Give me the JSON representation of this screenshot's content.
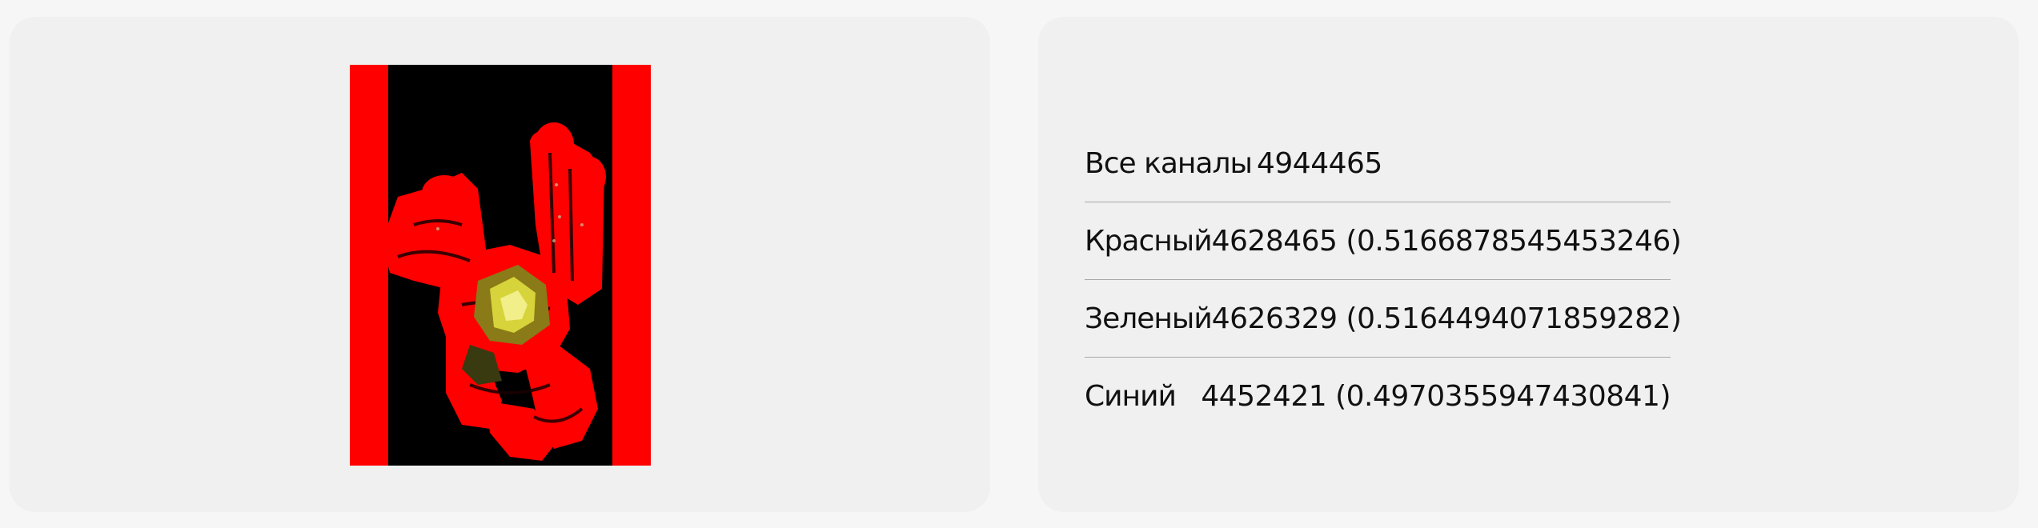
{
  "image_preview": {
    "description_icon": "red-channel-photo"
  },
  "stats": {
    "rows": [
      {
        "label": "Все каналы",
        "value": "4944465"
      },
      {
        "label": "Красный",
        "value": "4628465 (0.5166878545453246)"
      },
      {
        "label": "Зеленый",
        "value": "4626329 (0.5164494071859282)"
      },
      {
        "label": "Синий",
        "value": "4452421 (0.4970355947430841)"
      }
    ]
  },
  "colors": {
    "page_bg": "#f6f6f6",
    "card_bg": "#f0f0f0",
    "divider": "#a8a8a8",
    "red": "#ff0000",
    "black": "#000000",
    "highlight": "#d6d43a"
  }
}
